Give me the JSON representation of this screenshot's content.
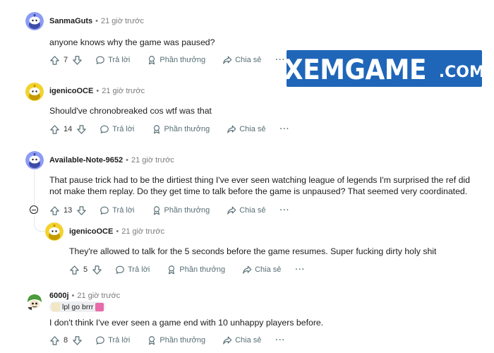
{
  "colors": {
    "logo_bg": "#1f66b9",
    "text_primary": "#1c1c1c",
    "text_meta": "#7c7c7c",
    "action": "#576f76"
  },
  "logo": {
    "main": "XEMGAME",
    "suffix": ".COM"
  },
  "labels": {
    "reply": "Trả lời",
    "award": "Phần thưởng",
    "share": "Chia sẻ",
    "more": "···"
  },
  "comments": [
    {
      "username": "SanmaGuts",
      "separator": "•",
      "time": "21 giờ trước",
      "text": "anyone knows why the game was paused?",
      "votes": "7",
      "avatar": "snoo-blue"
    },
    {
      "username": "igenicoOCE",
      "separator": "•",
      "time": "21 giờ trước",
      "text": "Should've chronobreaked cos wtf was that",
      "votes": "14",
      "avatar": "snoo-yellow"
    },
    {
      "username": "Available-Note-9652",
      "separator": "•",
      "time": "21 giờ trước",
      "text": "That pause trick had to be the dirtiest thing I've ever seen watching league of legends I'm surprised the ref did not make them replay. Do they get time to talk before the game is unpaused? That seemed very coordinated.",
      "votes": "13",
      "avatar": "snoo-blue"
    },
    {
      "username": "igenicoOCE",
      "separator": "•",
      "time": "21 giờ trước",
      "text": "They're allowed to talk for the 5 seconds before the game resumes. Super fucking dirty holy shit",
      "votes": "5",
      "avatar": "snoo-yellow"
    },
    {
      "username": "6000j",
      "separator": "•",
      "time": "21 giờ trước",
      "text": "I don't think I've ever seen a game end with 10 unhappy players before.",
      "votes": "8",
      "avatar": "custom",
      "flair": "lpl go brrr"
    }
  ]
}
